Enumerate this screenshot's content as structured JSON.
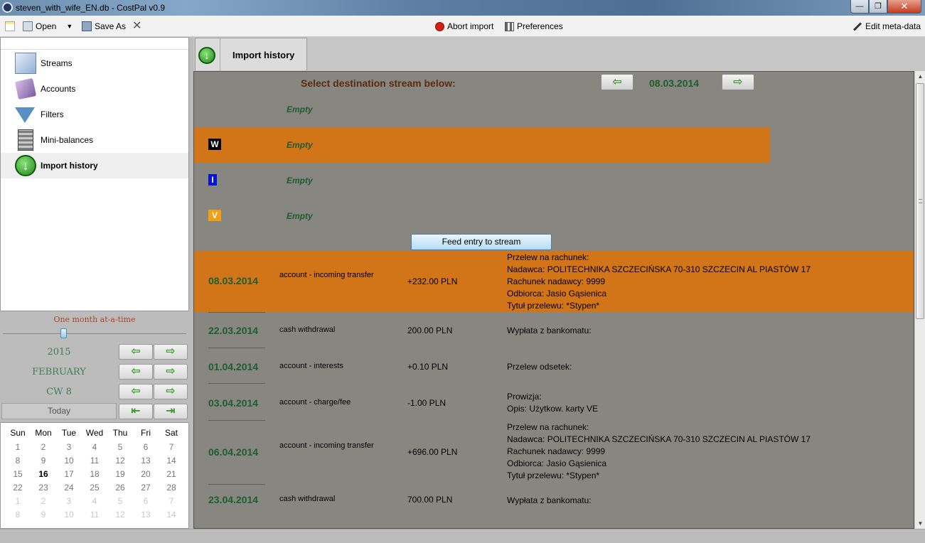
{
  "window": {
    "title": "steven_with_wife_EN.db - CostPal v0.9",
    "minimize": "—",
    "maximize": "❐",
    "close": "✕"
  },
  "toolbar": {
    "open_label": "Open",
    "save_as_label": "Save As",
    "abort_import_label": "Abort import",
    "preferences_label": "Preferences",
    "edit_meta_label": "Edit meta-data"
  },
  "nav": {
    "items": [
      {
        "label": "Streams",
        "icon": "streams-icon"
      },
      {
        "label": "Accounts",
        "icon": "accounts-icon"
      },
      {
        "label": "Filters",
        "icon": "filter-icon"
      },
      {
        "label": "Mini-balances",
        "icon": "calculator-icon"
      },
      {
        "label": "Import history",
        "icon": "import-icon",
        "selected": true
      }
    ]
  },
  "calendar_panel": {
    "range_label": "One month at-a-time",
    "year": "2015",
    "month": "FEBRUARY",
    "week": "CW 8",
    "today_label": "Today",
    "weekdays": [
      "Sun",
      "Mon",
      "Tue",
      "Wed",
      "Thu",
      "Fri",
      "Sat"
    ],
    "weeks": [
      [
        "1",
        "2",
        "3",
        "4",
        "5",
        "6",
        "7"
      ],
      [
        "8",
        "9",
        "10",
        "11",
        "12",
        "13",
        "14"
      ],
      [
        "15",
        "16",
        "17",
        "18",
        "19",
        "20",
        "21"
      ],
      [
        "22",
        "23",
        "24",
        "25",
        "26",
        "27",
        "28"
      ],
      [
        "1",
        "2",
        "3",
        "4",
        "5",
        "6",
        "7"
      ],
      [
        "8",
        "9",
        "10",
        "11",
        "12",
        "13",
        "14"
      ]
    ],
    "today_day": "16"
  },
  "tab": {
    "label": "Import history"
  },
  "main": {
    "select_prompt": "Select destination stream below:",
    "current_date": "08.03.2014",
    "feed_button": "Feed entry to stream",
    "streams": [
      {
        "badge": "",
        "empty_label": "Empty"
      },
      {
        "badge": "W",
        "empty_label": "Empty",
        "badge_bg": "#000000",
        "badge_fg": "#ffffff",
        "selected": true
      },
      {
        "badge": "I",
        "empty_label": "Empty",
        "badge_bg": "#0a14d8",
        "badge_fg": "#ffffff"
      },
      {
        "badge": "V",
        "empty_label": "Empty",
        "badge_bg": "#f0a010",
        "badge_fg": "#ffffff"
      }
    ],
    "entries": [
      {
        "date": "08.03.2014",
        "category": "account - incoming transfer",
        "amount": "+232.00 PLN",
        "description": "Przelew na rachunek:\nNadawca: POLITECHNIKA SZCZECIŃSKA 70-310 SZCZECIN AL PIASTÓW 17\nRachunek nadawcy: 9999\nOdbiorca: Jasio Gąsienica\nTytuł przelewu: *Stypen*",
        "selected": true
      },
      {
        "date": "22.03.2014",
        "category": "cash withdrawal",
        "amount": "200.00 PLN",
        "description": "Wypłata z bankomatu:"
      },
      {
        "date": "01.04.2014",
        "category": "account - interests",
        "amount": "+0.10 PLN",
        "description": "Przelew odsetek:"
      },
      {
        "date": "03.04.2014",
        "category": "account - charge/fee",
        "amount": "-1.00 PLN",
        "description": "Prowizja:\nOpis: Użytkow. karty VE"
      },
      {
        "date": "06.04.2014",
        "category": "account - incoming transfer",
        "amount": "+696.00 PLN",
        "description": "Przelew na rachunek:\nNadawca: POLITECHNIKA SZCZECIŃSKA 70-310 SZCZECIN AL PIASTÓW 17\nRachunek nadawcy: 9999\nOdbiorca: Jasio Gąsienica\nTytuł przelewu: *Stypen*"
      },
      {
        "date": "23.04.2014",
        "category": "cash withdrawal",
        "amount": "700.00 PLN",
        "description": "Wypłata z bankomatu:"
      }
    ]
  },
  "colors": {
    "selection_orange": "#d27418",
    "content_bg": "#888681",
    "date_green": "#1d5e30"
  }
}
